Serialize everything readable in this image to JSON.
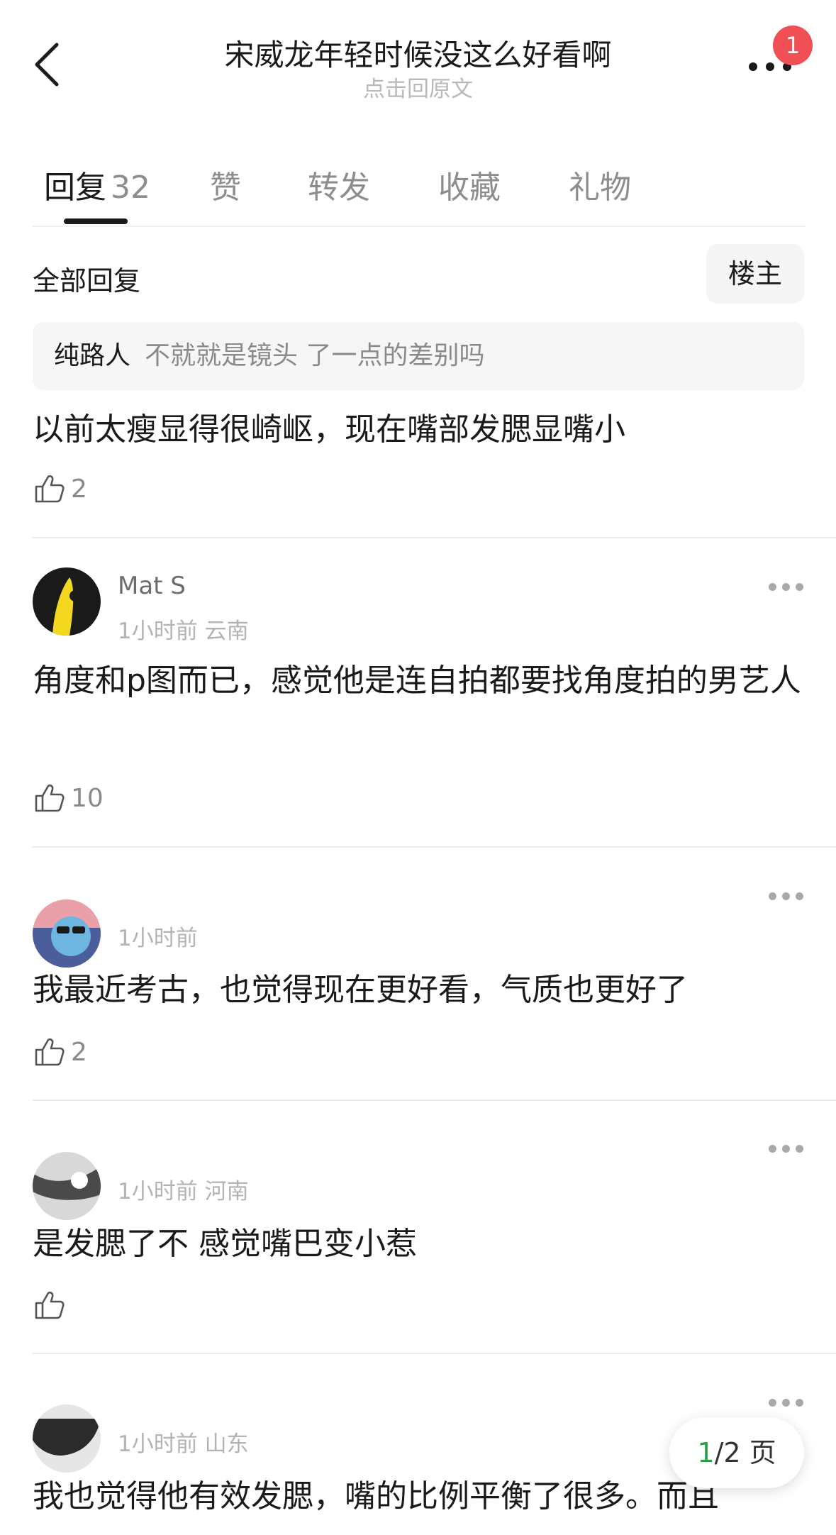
{
  "header": {
    "title": "宋威龙年轻时候没这么好看啊",
    "subtitle": "点击回原文",
    "badge_count": "1"
  },
  "tabs": [
    {
      "label": "回复",
      "count": "32"
    },
    {
      "label": "赞"
    },
    {
      "label": "转发"
    },
    {
      "label": "收藏"
    },
    {
      "label": "礼物"
    }
  ],
  "filter": {
    "all_replies": "全部回复",
    "op_only": "楼主"
  },
  "comments": [
    {
      "quote_author": "纯路人",
      "quote_text": "不就就是镜头 了一点的差别吗",
      "text": "以前太瘦显得很崎岖，现在嘴部发腮显嘴小",
      "likes": "2"
    },
    {
      "username": "Mat S",
      "meta": "1小时前 云南",
      "text": "角度和p图而已，感觉他是连自拍都要找角度拍的男艺人",
      "likes": "10"
    },
    {
      "meta": "1小时前",
      "text": "我最近考古，也觉得现在更好看，气质也更好了",
      "likes": "2"
    },
    {
      "meta": "1小时前 河南",
      "text": "是发腮了不  感觉嘴巴变小惹",
      "likes": ""
    },
    {
      "meta": "1小时前 山东",
      "text": "我也觉得他有效发腮，嘴的比例平衡了很多。而且",
      "likes": ""
    }
  ],
  "pagination": {
    "current": "1",
    "total_text": "/2 页"
  },
  "colors": {
    "badge": "#f04f55",
    "page_current": "#2aa04a",
    "muted_text": "#8a8a8a"
  }
}
